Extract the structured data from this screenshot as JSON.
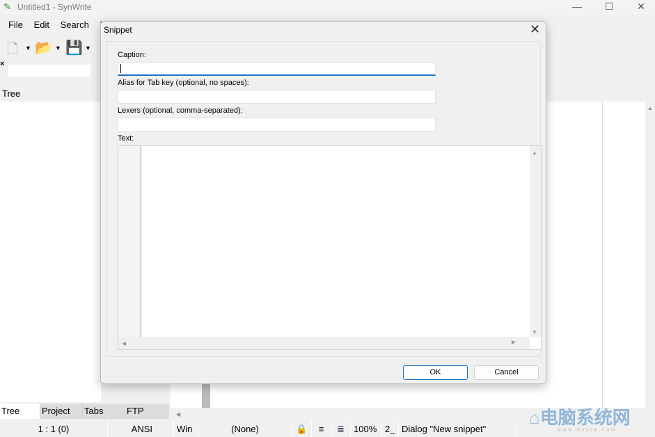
{
  "window": {
    "title": "Untitled1 - SynWrite",
    "minimize": "—",
    "maximize": "☐",
    "close": "✕"
  },
  "menu": [
    "File",
    "Edit",
    "Search",
    "E"
  ],
  "sidebar": {
    "header": "Tree"
  },
  "bottom_tabs": [
    "Tree",
    "Project",
    "Tabs",
    "FTP"
  ],
  "status": {
    "position": "1 : 1 (0)",
    "encoding": "ANSI",
    "line_ending": "Win",
    "lexer": "(None)",
    "zoom": "100%",
    "tab": "2_",
    "message": "Dialog \"New snippet\""
  },
  "dialog": {
    "title": "Snippet",
    "caption_label": "Caption:",
    "caption_value": "",
    "alias_label": "Alias for Tab key (optional, no spaces):",
    "alias_value": "",
    "lexers_label": "Lexers (optional, comma-separated):",
    "lexers_value": "",
    "text_label": "Text:",
    "text_value": "",
    "ok": "OK",
    "cancel": "Cancel"
  },
  "watermark": {
    "text": "电脑系统网",
    "url": "w w w . d n x t w . c o m"
  }
}
